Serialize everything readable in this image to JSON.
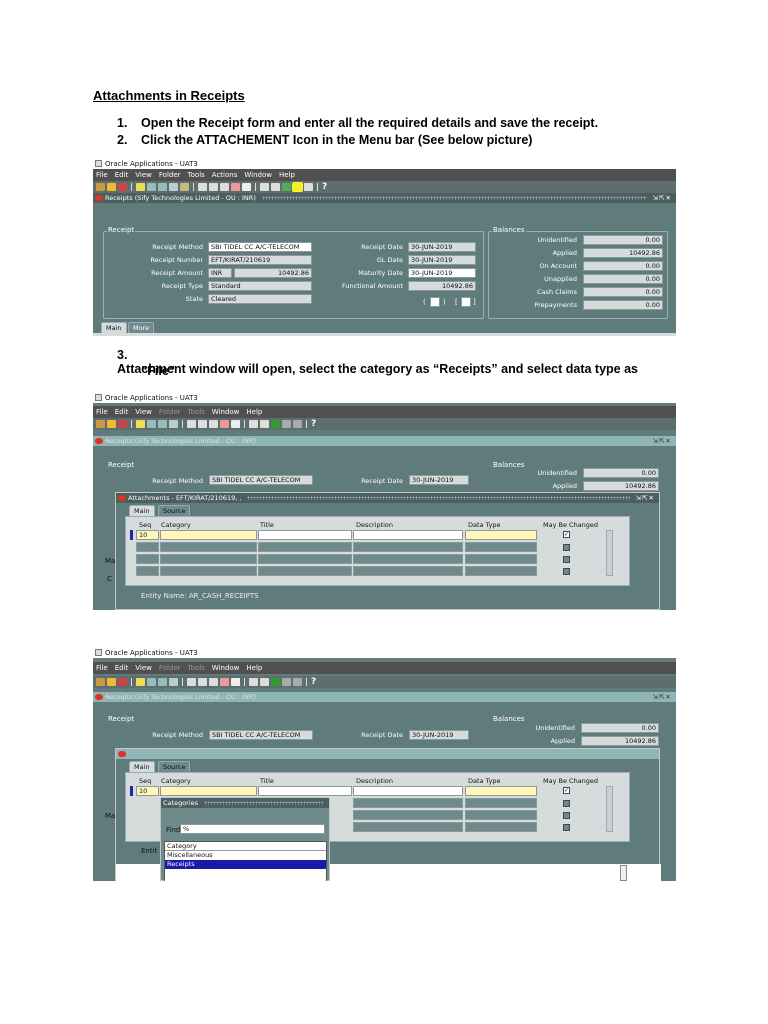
{
  "doc": {
    "title": "Attachments in Receipts",
    "steps": [
      {
        "num": "1.",
        "text": "Open the Receipt form and enter all the required details and save the receipt."
      },
      {
        "num": "2.",
        "text": "Click the ATTACHEMENT Icon in the Menu bar (See below picture)"
      },
      {
        "num": "3.",
        "text": "Attachment window will open, select the category as “Receipts” and select data type as",
        "text2": "“File”"
      }
    ]
  },
  "app": {
    "window_title": "Oracle Applications - UAT3",
    "menu1": [
      "File",
      "Edit",
      "View",
      "Folder",
      "Tools",
      "Actions",
      "Window",
      "Help"
    ],
    "menu2": [
      "File",
      "Edit",
      "View",
      "Folder",
      "Tools",
      "Window",
      "Help"
    ],
    "receipts_title": "Receipts (Sify Technologies Limited - OU : INR)"
  },
  "receipt": {
    "section": "Receipt",
    "labels": {
      "method": "Receipt Method",
      "number": "Receipt Number",
      "amount": "Receipt Amount",
      "type": "Receipt Type",
      "state": "State",
      "receipt_date": "Receipt Date",
      "gl_date": "GL Date",
      "maturity_date": "Maturity Date",
      "functional_amount": "Functional Amount"
    },
    "method": "SBI TIDEL CC A/C-TELECOM",
    "number": "EFT/KIRAT/210619",
    "currency": "INR",
    "amount": "10492.86",
    "type": "Standard",
    "state": "Cleared",
    "receipt_date": "30-JUN-2019",
    "gl_date": "30-JUN-2019",
    "maturity_date": "30-JUN-2019",
    "functional_amount": "10492.86",
    "paren_open": "(",
    "paren_close": ")",
    "bracket_open": "[",
    "bracket_close": "]"
  },
  "balances": {
    "section": "Balances",
    "rows": [
      {
        "label": "Unidentified",
        "value": "0.00"
      },
      {
        "label": "Applied",
        "value": "10492.86"
      },
      {
        "label": "On Account",
        "value": "0.00"
      },
      {
        "label": "Unapplied",
        "value": "0.00"
      },
      {
        "label": "Cash Claims",
        "value": "0.00"
      },
      {
        "label": "Prepayments",
        "value": "0.00"
      }
    ]
  },
  "tabs": {
    "main": "Main",
    "more": "More",
    "source": "Source"
  },
  "attachments": {
    "title": "Attachments - EFT/KIRAT/210619, ,",
    "cols": {
      "seq": "Seq",
      "category": "Category",
      "title": "Title",
      "description": "Description",
      "data_type": "Data Type",
      "may_change": "May Be Changed"
    },
    "seq_value": "10",
    "entity": "Entity Name:  AR_CASH_RECEIPTS",
    "entity_short": "Entit",
    "check_mark": "✓"
  },
  "categories": {
    "title": "Categories",
    "find_label": "Find",
    "find_value": "%",
    "items": [
      "Category",
      "Miscellaneous",
      "Receipts"
    ]
  },
  "frag": {
    "ma": "Ma",
    "c": "C"
  }
}
